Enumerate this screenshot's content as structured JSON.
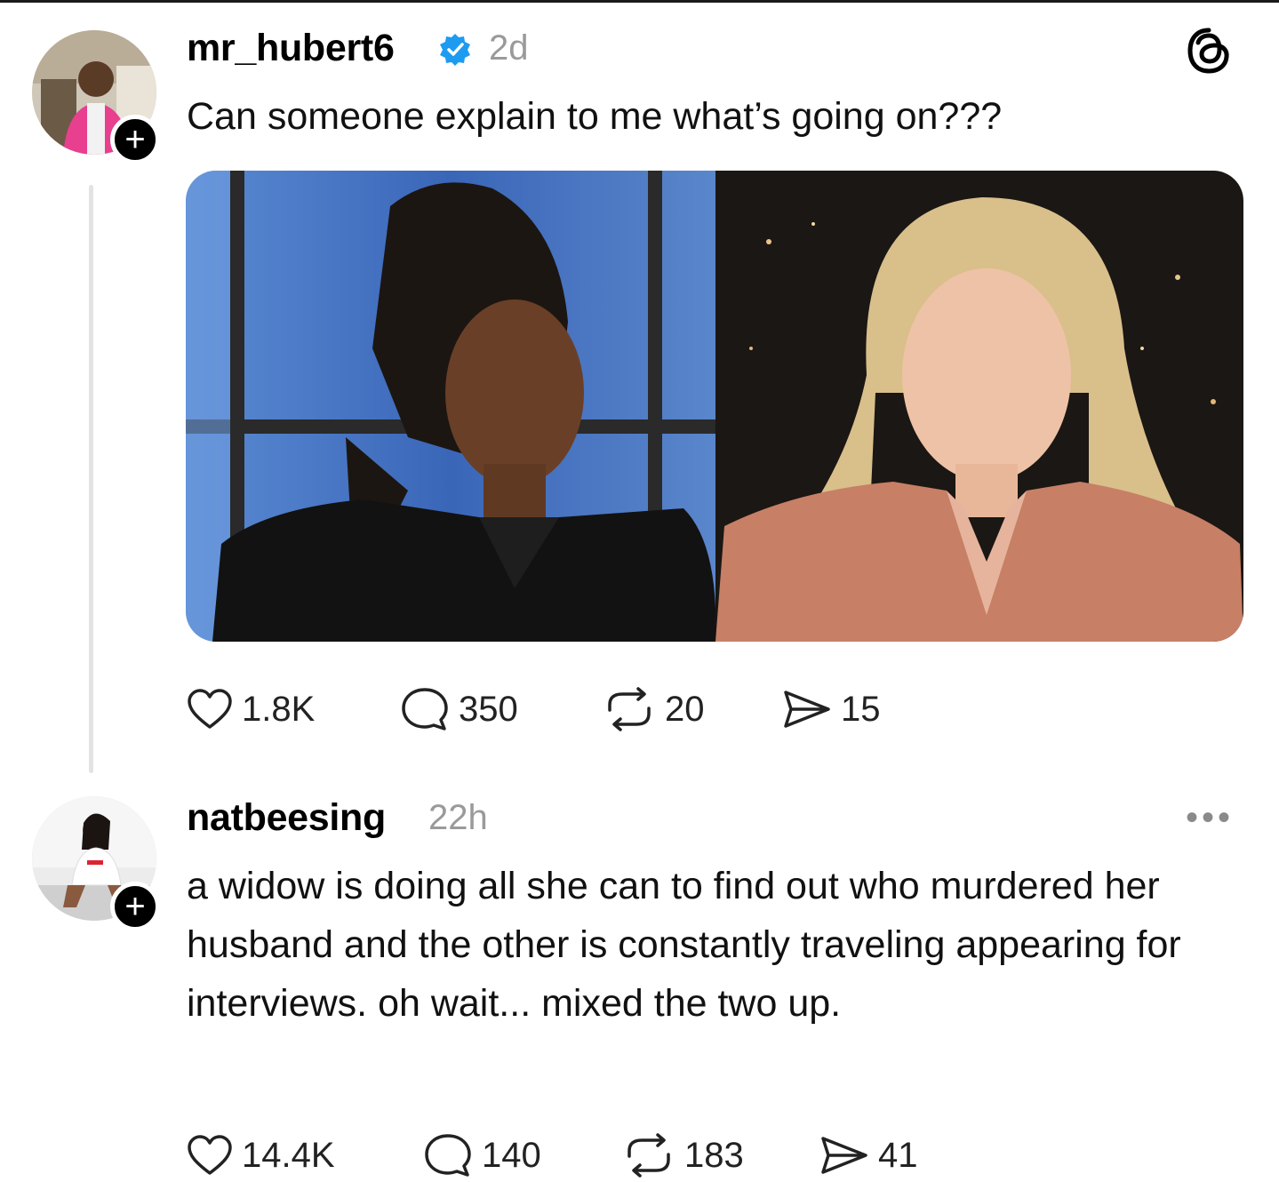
{
  "posts": [
    {
      "username": "mr_hubert6",
      "verified": true,
      "time": "2d",
      "text": "Can someone explain to me what’s going on???",
      "stats": {
        "likes": "1.8K",
        "replies": "350",
        "reposts": "20",
        "shares": "15"
      }
    },
    {
      "username": "natbeesing",
      "verified": false,
      "time": "22h",
      "text": "a widow is doing all she can to find out who murdered her husband and the other is constantly traveling appearing for interviews. oh wait... mixed the two up.",
      "stats": {
        "likes": "14.4K",
        "replies": "140",
        "reposts": "183",
        "shares": "41"
      }
    }
  ],
  "icons": {
    "follow": "+",
    "more": "•••",
    "app_logo": "threads-logo"
  },
  "colors": {
    "verified_badge": "#1d9bf0",
    "muted_text": "#9a9a9a",
    "thread_line": "#e3e3e3"
  }
}
